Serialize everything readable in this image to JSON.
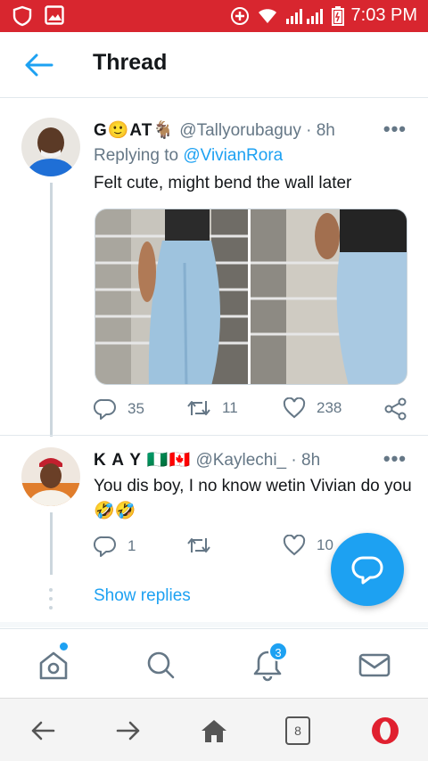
{
  "status_bar": {
    "time": "7:03 PM"
  },
  "header": {
    "title": "Thread"
  },
  "tweets": [
    {
      "name": "G🙂AT🐐",
      "handle": "@Tallyorubaguy",
      "time": "· 8h",
      "replying_prefix": "Replying to ",
      "replying_to": "@VivianRora",
      "text": "Felt cute, might bend the wall later",
      "replies": "35",
      "retweets": "11",
      "likes": "238"
    },
    {
      "name": "K A Y 🇳🇬🇨🇦",
      "handle": "@Kaylechi_",
      "time": "· 8h",
      "text": "You dis boy, I no know wetin Vivian do you 🤣🤣",
      "replies": "1",
      "likes": "10"
    }
  ],
  "show_replies": "Show replies",
  "bottom_nav": {
    "notification_count": "3"
  },
  "browser": {
    "tab_count": "8"
  },
  "colors": {
    "status_bar": "#d8262f",
    "accent": "#1da1f2",
    "secondary_text": "#657786",
    "opera_red": "#e0202f"
  }
}
